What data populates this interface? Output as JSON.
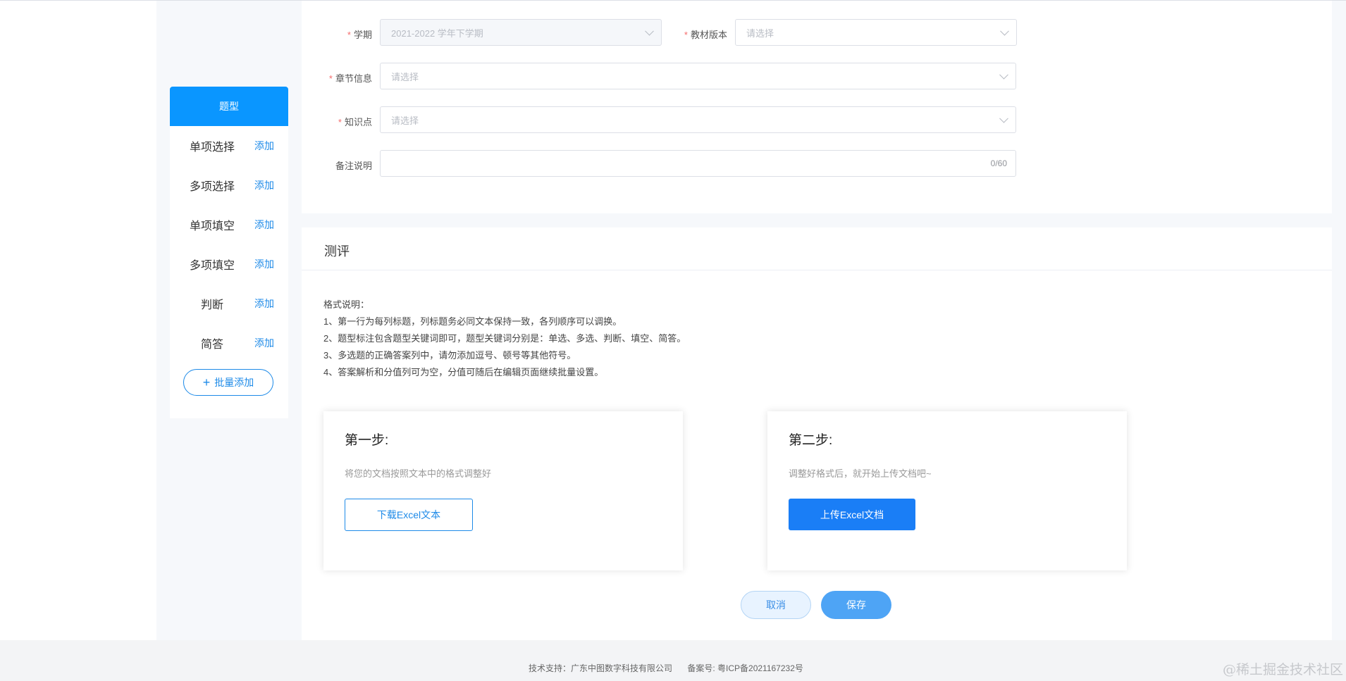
{
  "sidebar": {
    "header": "题型",
    "add_label": "添加",
    "items": [
      {
        "label": "单项选择"
      },
      {
        "label": "多项选择"
      },
      {
        "label": "单项填空"
      },
      {
        "label": "多项填空"
      },
      {
        "label": "判断"
      },
      {
        "label": "简答"
      }
    ],
    "batch_add": "批量添加"
  },
  "form": {
    "semester": {
      "label": "学期",
      "value": "2021-2022 学年下学期"
    },
    "textbook_version": {
      "label": "教材版本",
      "placeholder": "请选择"
    },
    "chapter": {
      "label": "章节信息",
      "placeholder": "请选择"
    },
    "knowledge": {
      "label": "知识点",
      "placeholder": "请选择"
    },
    "remark": {
      "label": "备注说明",
      "counter": "0/60"
    }
  },
  "evaluation": {
    "title": "测评",
    "instructions": [
      "格式说明：",
      "1、第一行为每列标题，列标题务必同文本保持一致，各列顺序可以调换。",
      "2、题型标注包含题型关键词即可，题型关键词分别是：单选、多选、判断、填空、简答。",
      "3、多选题的正确答案列中，请勿添加逗号、顿号等其他符号。",
      "4、答案解析和分值列可为空，分值可随后在编辑页面继续批量设置。"
    ],
    "step1": {
      "title": "第一步:",
      "desc": "将您的文档按照文本中的格式调整好",
      "button": "下载Excel文本"
    },
    "step2": {
      "title": "第二步:",
      "desc": "调整好格式后，就开始上传文档吧~",
      "button": "上传Excel文档"
    }
  },
  "actions": {
    "cancel": "取消",
    "save": "保存"
  },
  "footer": {
    "support": "技术支持：广东中图数字科技有限公司",
    "icp": "备案号: 粤ICP备2021167232号"
  },
  "watermark": "@稀土掘金技术社区",
  "colors": {
    "primary": "#0a96ff",
    "button_blue": "#1a7ef6",
    "required": "#f56c6c"
  }
}
